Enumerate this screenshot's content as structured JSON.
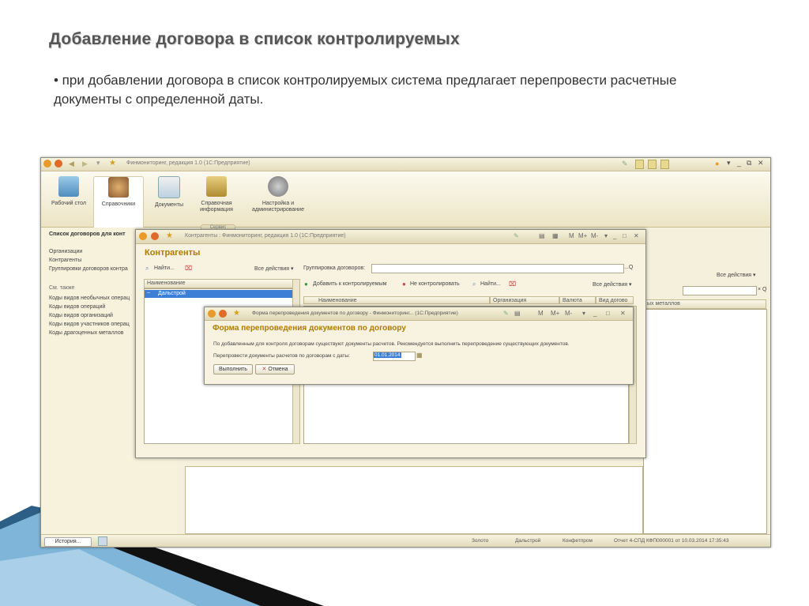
{
  "slide": {
    "title": "Добавление договора в список контролируемых",
    "bullet": "• при добавлении договора в список контролируемых система предлагает перепровести расчетные документы с определенной даты."
  },
  "main_window": {
    "title": "Финмониторинг, редакция 1.0  (1С:Предприятие)",
    "sections": [
      {
        "label": "Рабочий стол",
        "icon": "desktop-icon"
      },
      {
        "label": "Справочники",
        "icon": "people-icon"
      },
      {
        "label": "Документы",
        "icon": "documents-icon"
      },
      {
        "label": "Справочная информация",
        "icon": "book-icon"
      },
      {
        "label": "Настройка и администрирование",
        "icon": "settings-gear-icon"
      }
    ],
    "service_tab": "Сервис",
    "left_panel": {
      "header": "Список договоров для конт",
      "links": [
        "Организации",
        "Контрагенты",
        "Группировки договоров контра"
      ],
      "see_also": "См. также",
      "more_links": [
        "Коды видов необычных операц",
        "Коды видов операций",
        "Коды видов организаций",
        "Коды видов участников операц",
        "Коды драгоценных металлов"
      ]
    },
    "right_area": {
      "actions": "Все действия ▾",
      "column_fragment": "ых металлов",
      "search_btn": "×  Q"
    },
    "status_bar": {
      "history": "История...",
      "items": [
        "Золото",
        "Дальстрой",
        "Конфетпром",
        "Отчет 4-СПД КФП000001 от 10.03.2014 17:35:43"
      ]
    }
  },
  "contractors_window": {
    "title": "Контрагенты : Финмониторинг, редакция 1.0  (1С:Предприятие)",
    "heading": "Контрагенты",
    "find": "Найти...",
    "all_actions_left": "Все действия ▾",
    "grouping_label": "Группировка договоров:",
    "add_to_control": "Добавить к контролируемым",
    "not_control": "Не контролировать",
    "find2": "Найти...",
    "all_actions_right": "Все действия ▾",
    "left_col": "Наименование",
    "left_row": "Дальстрой",
    "columns": [
      "Наименование",
      "Организация",
      "Валюта",
      "Вид догово"
    ]
  },
  "reprocess_window": {
    "title": "Форма перепроведения документов по договору - Финмониторинг... (1С:Предприятие)",
    "heading": "Форма перепроведения документов по договору",
    "message": "По добавленным для контроля договорам существуют документы расчетов. Рекомендуется выполнить перепроведение существующих документов.",
    "date_label": "Перепровести документы расчетов по договорам с даты:",
    "date_value": "01.01.2014",
    "run_btn": "Выполнить",
    "cancel_btn": "Отмена"
  }
}
